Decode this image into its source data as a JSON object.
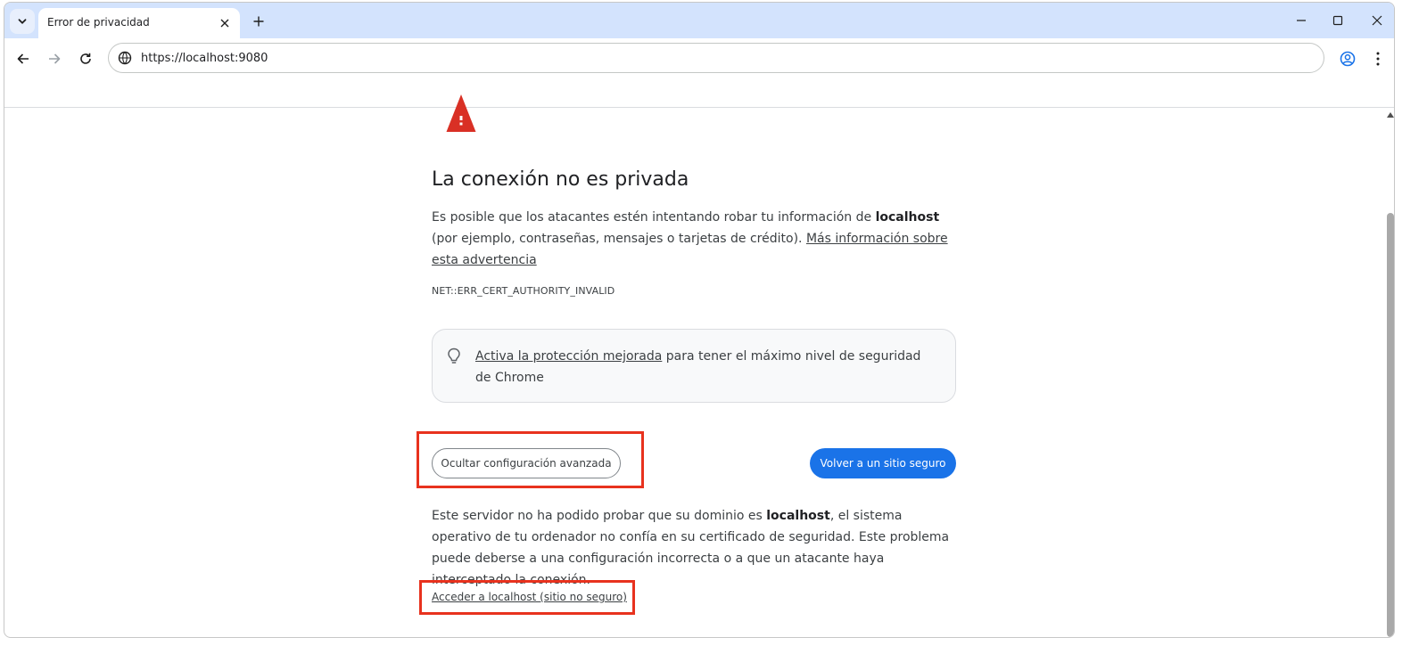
{
  "browser": {
    "tab_title": "Error de privacidad",
    "url": "https://localhost:9080"
  },
  "page": {
    "heading": "La conexión no es privada",
    "intro_prefix": "Es posible que los atacantes estén intentando robar tu información de ",
    "intro_host": "localhost",
    "intro_suffix": " (por ejemplo, contraseñas, mensajes o tarjetas de crédito). ",
    "intro_link": "Más información sobre esta advertencia",
    "error_code": "NET::ERR_CERT_AUTHORITY_INVALID",
    "callout_link": "Activa la protección mejorada",
    "callout_text": " para tener el máximo nivel de seguridad de Chrome",
    "advanced_button": "Ocultar configuración avanzada",
    "back_button": "Volver a un sitio seguro",
    "details_prefix": "Este servidor no ha podido probar que su dominio es ",
    "details_host": "localhost",
    "details_suffix": ", el sistema operativo de tu ordenador no confía en su certificado de seguridad. Este problema puede deberse a una configuración incorrecta o a que un atacante haya interceptado la conexión.",
    "proceed_link": "Acceder a localhost (sitio no seguro)"
  },
  "colors": {
    "accent": "#1a73e8",
    "warning_red": "#d93025",
    "highlight_red": "#e8321e",
    "tabstrip": "#d3e3fd"
  },
  "icons": [
    "chevron-down-icon",
    "close-icon",
    "plus-icon",
    "minimize-icon",
    "maximize-icon",
    "back-icon",
    "forward-icon",
    "reload-icon",
    "site-info-icon",
    "profile-icon",
    "menu-icon",
    "warning-icon",
    "lightbulb-icon"
  ]
}
